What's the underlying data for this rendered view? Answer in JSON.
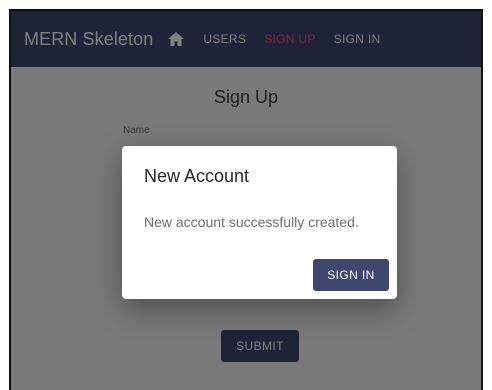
{
  "appbar": {
    "title": "MERN Skeleton",
    "home_icon": "home-icon",
    "nav": [
      {
        "label": "USERS",
        "active": false
      },
      {
        "label": "SIGN UP",
        "active": true
      },
      {
        "label": "SIGN IN",
        "active": false
      }
    ]
  },
  "form": {
    "title": "Sign Up",
    "name_label": "Name",
    "submit_label": "SUBMIT"
  },
  "dialog": {
    "title": "New Account",
    "message": "New account successfully created.",
    "button_label": "SIGN IN"
  },
  "colors": {
    "primary": "#3f4771",
    "accent": "#ff4081"
  }
}
